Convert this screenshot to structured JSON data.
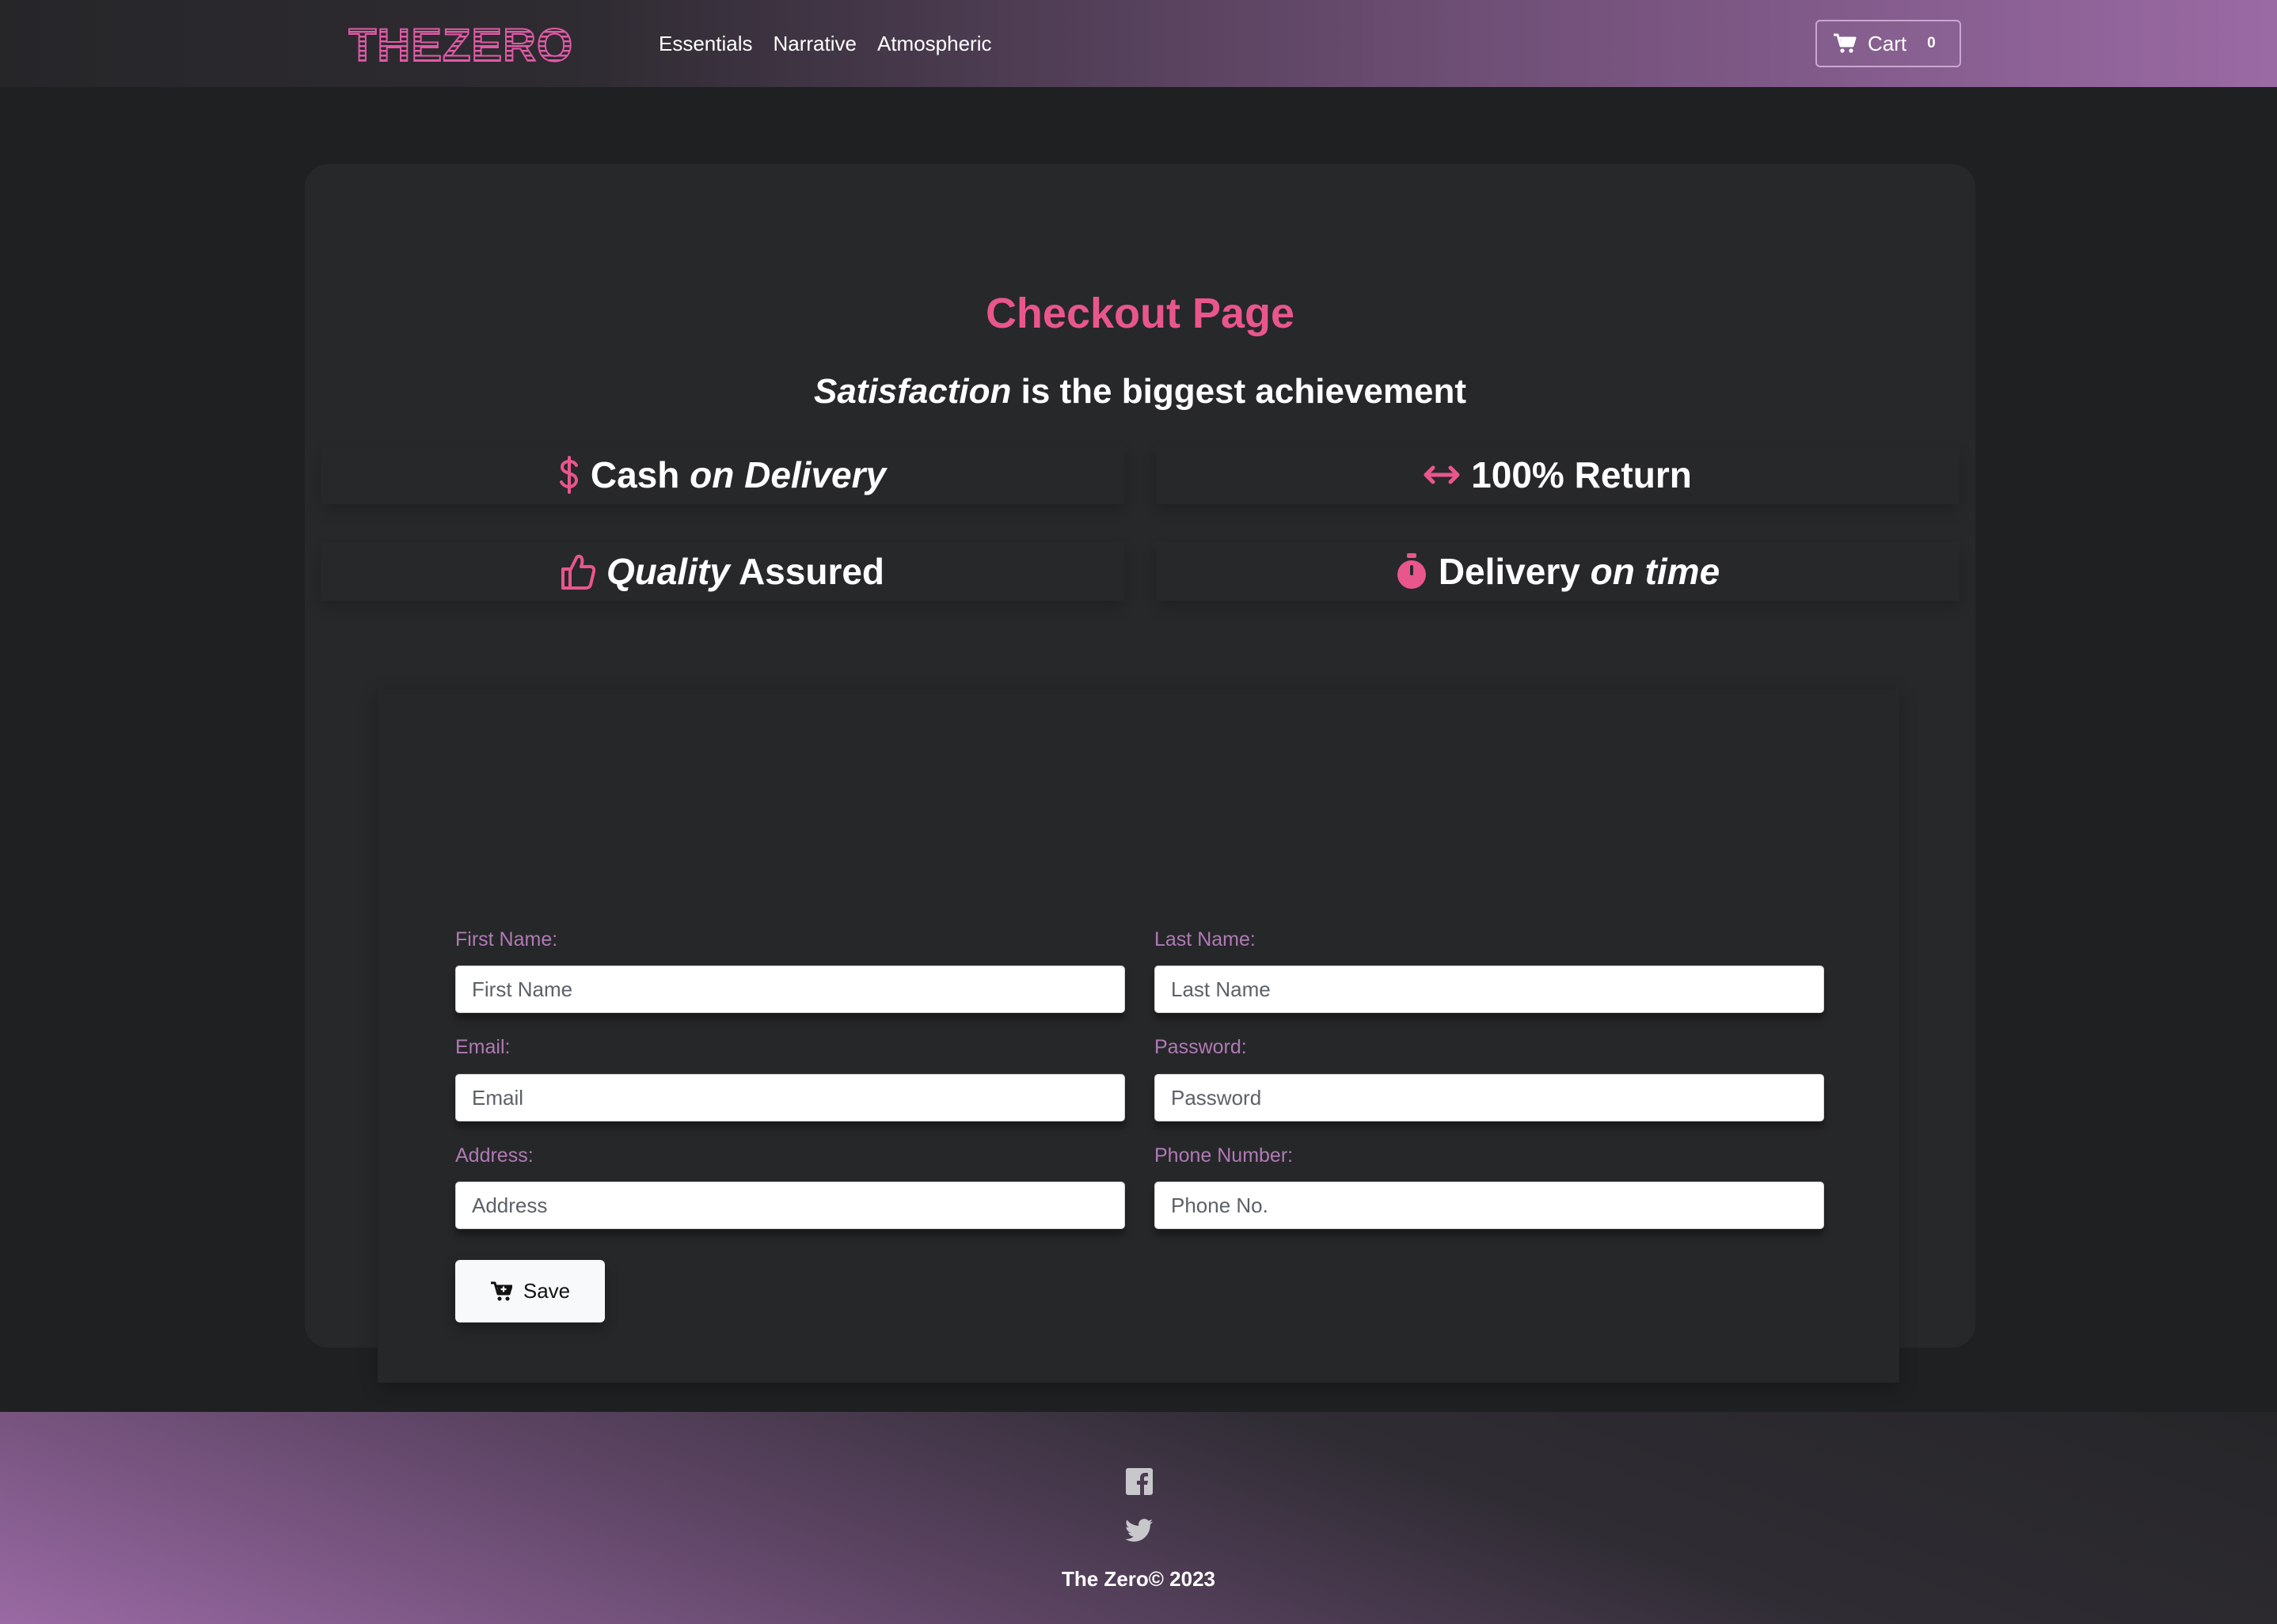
{
  "brand": {
    "logo_text": "THEZERO"
  },
  "nav": {
    "links": [
      {
        "label": "Essentials"
      },
      {
        "label": "Narrative"
      },
      {
        "label": "Atmospheric"
      }
    ]
  },
  "cart": {
    "label": "Cart",
    "count": "0",
    "icon": "cart-icon"
  },
  "hero": {
    "title": "Checkout Page",
    "tagline_em": "Satisfaction",
    "tagline_rest": " is the biggest achievement"
  },
  "features": [
    {
      "icon": "dollar-icon",
      "text_a": "Cash ",
      "text_em": "on Delivery",
      "text_b": ""
    },
    {
      "icon": "arrows-horizontal-icon",
      "text_a": "100% Return",
      "text_em": "",
      "text_b": ""
    },
    {
      "icon": "thumbs-up-icon",
      "text_a": "",
      "text_em": "Quality",
      "text_b": " Assured"
    },
    {
      "icon": "stopwatch-icon",
      "text_a": "Delivery ",
      "text_em": "on time",
      "text_b": ""
    }
  ],
  "form": {
    "first_name": {
      "label": "First Name:",
      "placeholder": "First Name",
      "value": ""
    },
    "last_name": {
      "label": "Last Name:",
      "placeholder": "Last Name",
      "value": ""
    },
    "email": {
      "label": "Email:",
      "placeholder": "Email",
      "value": ""
    },
    "password": {
      "label": "Password:",
      "placeholder": "Password",
      "value": ""
    },
    "address": {
      "label": "Address:",
      "placeholder": "Address",
      "value": ""
    },
    "phone": {
      "label": "Phone Number:",
      "placeholder": "Phone No.",
      "value": ""
    },
    "save_label": "Save"
  },
  "footer": {
    "social": [
      "facebook-icon",
      "twitter-icon"
    ],
    "copyright": "The Zero© 2023"
  },
  "colors": {
    "accent_pink": "#e9568c",
    "label_purple": "#b07ab5",
    "page_bg": "#1e2021",
    "card_bg": "#27282a"
  }
}
